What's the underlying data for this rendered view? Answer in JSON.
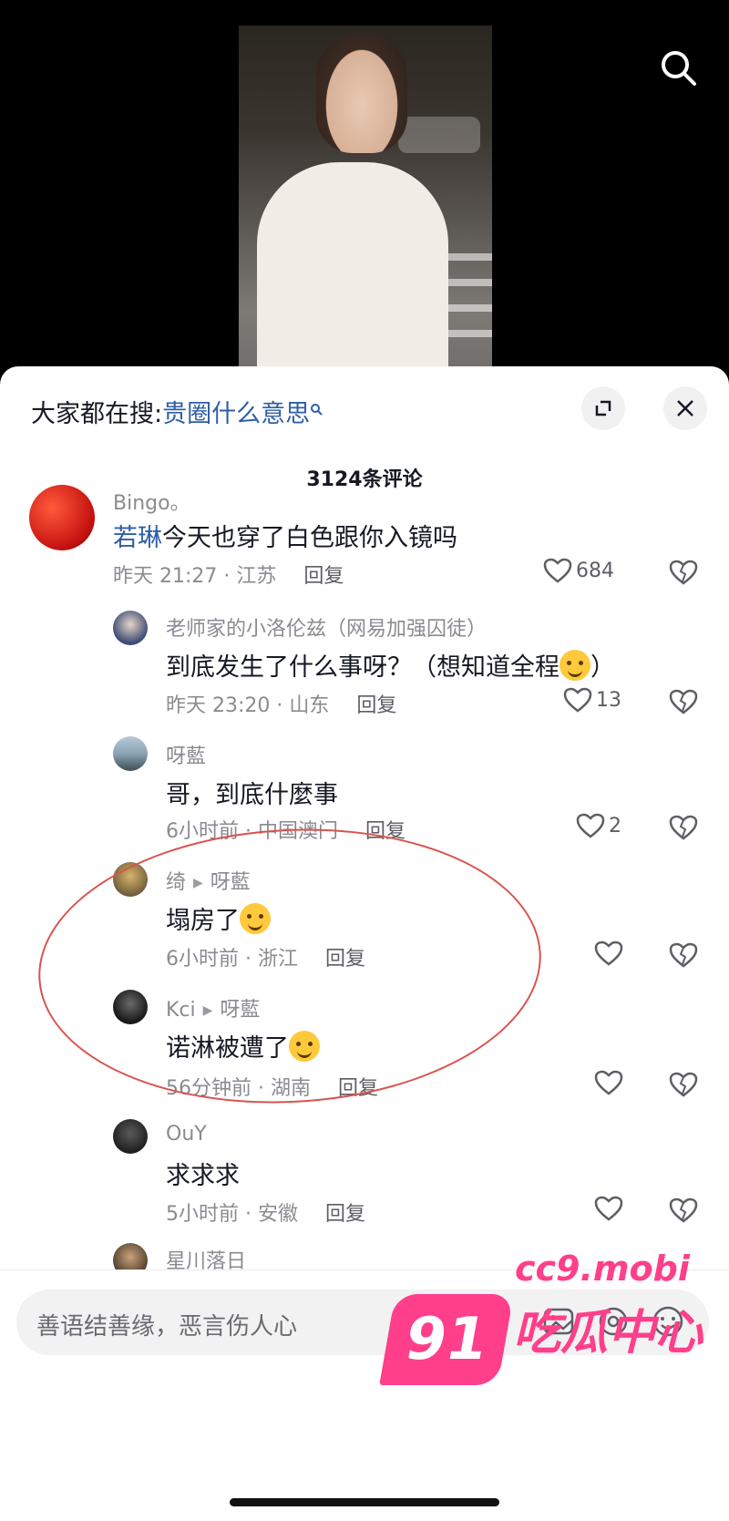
{
  "header": {
    "search_icon": "search-icon"
  },
  "sheet": {
    "hot_search_prefix": "大家都在搜:",
    "hot_search_term": "贵圈什么意思",
    "comment_count_label": "3124条评论",
    "buttons": {
      "expand_icon": "expand-icon",
      "close_icon": "close-icon"
    }
  },
  "comments": [
    {
      "user": "Bingo。",
      "mention": "若琳",
      "text": "今天也穿了白色跟你入镜吗",
      "meta": "昨天 21:27 · 江苏",
      "reply_label": "回复",
      "likes": "684"
    },
    {
      "user": "老师家的小洛伦兹（网易加强囚徒）",
      "text": "到底发生了什么事呀？（想知道全程",
      "text_tail": "）",
      "meta": "昨天 23:20 · 山东",
      "reply_label": "回复",
      "likes": "13"
    },
    {
      "user": "呀藍",
      "text": "哥，到底什麼事",
      "meta": "6小时前 · 中国澳门",
      "reply_label": "回复",
      "likes": "2"
    },
    {
      "user": "绮",
      "reply_to": "呀藍",
      "text": "塌房了",
      "meta": "6小时前 · 浙江",
      "reply_label": "回复",
      "likes": ""
    },
    {
      "user": "Kci",
      "reply_to": "呀藍",
      "text": "诺淋被遭了",
      "meta": "56分钟前 · 湖南",
      "reply_label": "回复",
      "likes": ""
    },
    {
      "user": "OuY",
      "text": "求求求",
      "meta": "5小时前 · 安徽",
      "reply_label": "回复",
      "likes": ""
    },
    {
      "user": "星川落日"
    }
  ],
  "input": {
    "placeholder": "善语结善缘，恶言伤人心"
  },
  "watermark": {
    "badge": "91",
    "url": "cc9.mobi",
    "name": "吃瓜中心"
  },
  "colors": {
    "link": "#2f5ea5",
    "muted": "#8a8b91",
    "annotation": "#d9534f",
    "watermark": "#ff3f8a"
  }
}
